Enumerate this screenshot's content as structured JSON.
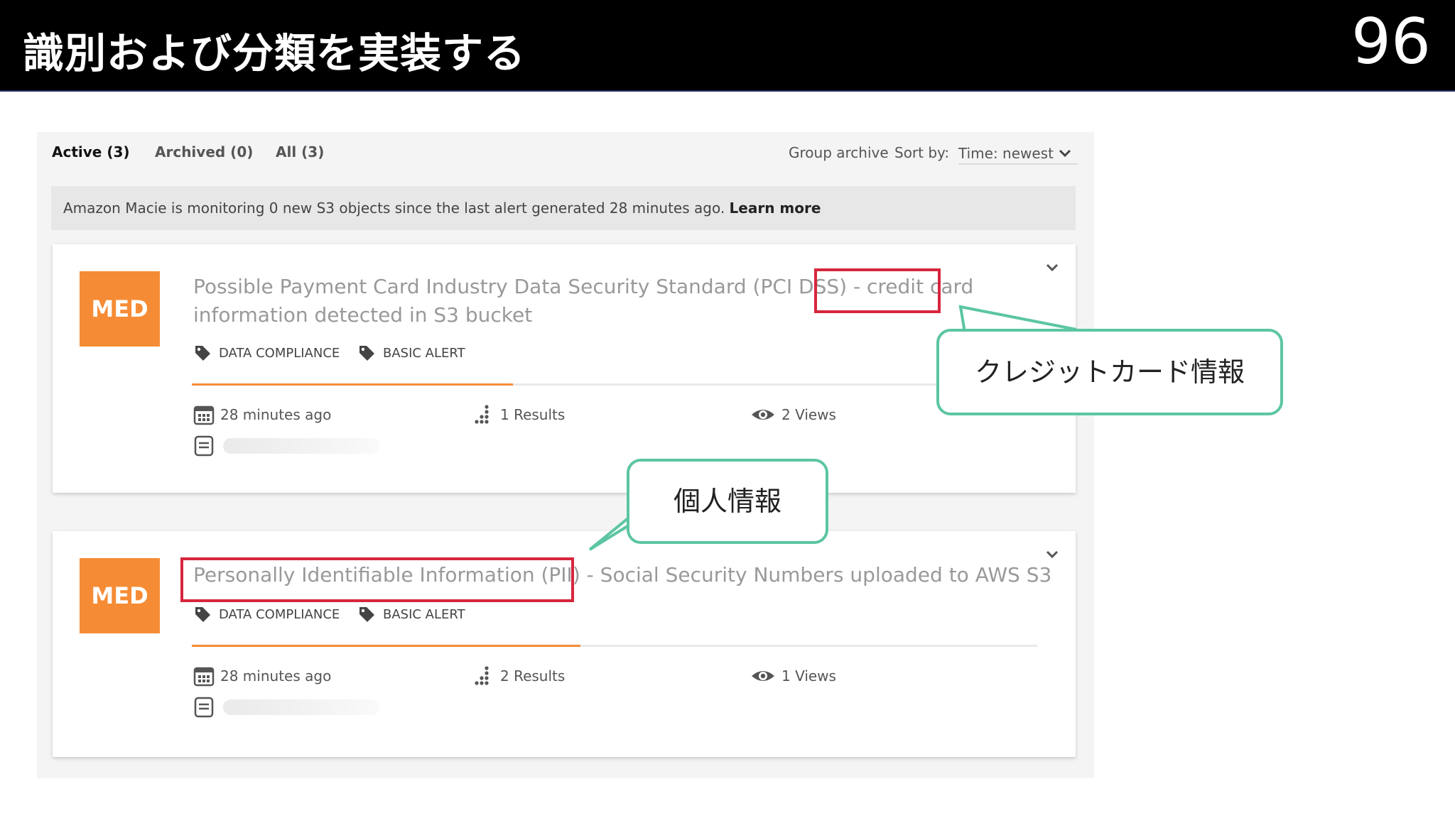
{
  "slide": {
    "title": "識別および分類を実装する",
    "number": "96"
  },
  "tabs": [
    {
      "label": "Active (3)"
    },
    {
      "label": "Archived (0)"
    },
    {
      "label": "All (3)"
    }
  ],
  "toolbar": {
    "group_archive": "Group archive",
    "sort_label": "Sort by:",
    "sort_value": "Time: newest"
  },
  "notice": {
    "text": "Amazon Macie is monitoring 0 new S3 objects since the last alert generated 28 minutes ago.",
    "link": "Learn more"
  },
  "alerts": [
    {
      "severity": "MED",
      "title_prefix": "Possible Payment Card Industry Data Security Standard (PCI DSS)",
      "title_sep": "-",
      "title_highlight": "credit card",
      "title_line2": "information detected in S3 bucket",
      "tags": [
        "DATA COMPLIANCE",
        "BASIC ALERT"
      ],
      "progress": 0.38,
      "time": "28 minutes ago",
      "results": "1 Results",
      "views": "2 Views"
    },
    {
      "severity": "MED",
      "title_highlight": "Personally Identifiable Information (PII)",
      "title_sep": "-",
      "title_rest": "Social Security Numbers uploaded to AWS S3",
      "tags": [
        "DATA COMPLIANCE",
        "BASIC ALERT"
      ],
      "progress": 0.46,
      "time": "28 minutes ago",
      "results": "2 Results",
      "views": "1 Views"
    }
  ],
  "callouts": {
    "credit_card": "クレジットカード情報",
    "pii": "個人情報"
  },
  "colors": {
    "severity_med": "#f58c35",
    "highlight_red": "#d7263d",
    "callout_green": "#5cc5a3"
  }
}
